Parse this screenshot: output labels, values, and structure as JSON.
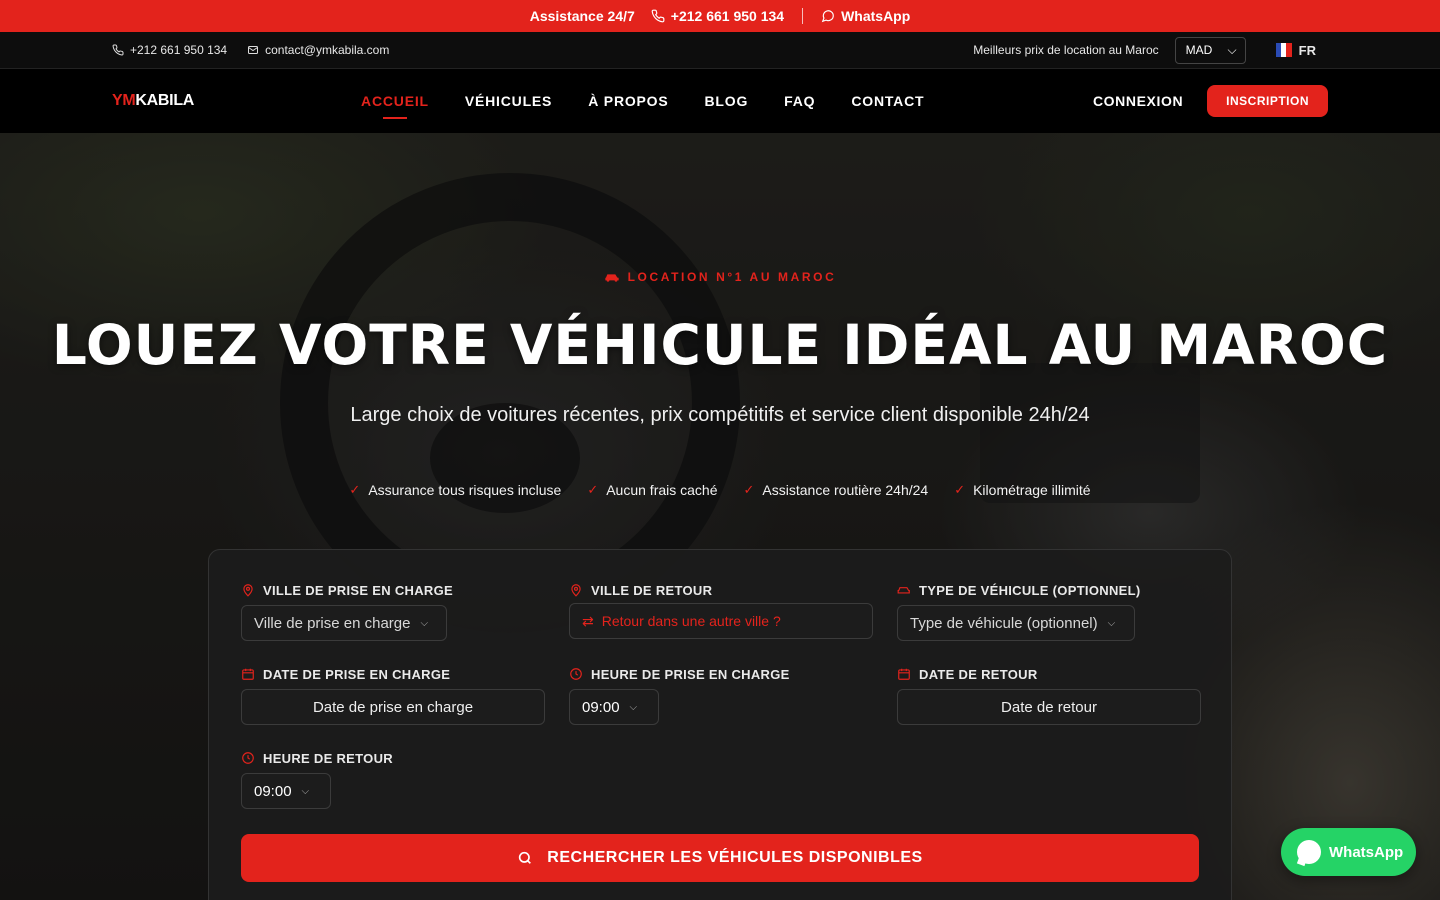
{
  "topbar": {
    "assistance": "Assistance 24/7",
    "phone": "+212 661 950 134",
    "whatsapp": "WhatsApp"
  },
  "contactbar": {
    "phone": "+212 661 950 134",
    "email": "contact@ymkabila.com",
    "tagline": "Meilleurs prix de location au Maroc",
    "currency": "MAD",
    "language": "FR"
  },
  "nav": {
    "logo_prefix": "YM",
    "logo_suffix": "KABILA",
    "items": [
      {
        "label": "ACCUEIL"
      },
      {
        "label": "VÉHICULES"
      },
      {
        "label": "À PROPOS"
      },
      {
        "label": "BLOG"
      },
      {
        "label": "FAQ"
      },
      {
        "label": "CONTACT"
      }
    ],
    "active_index": 0,
    "login": "CONNEXION",
    "register": "INSCRIPTION"
  },
  "hero": {
    "kicker": "LOCATION N°1 AU MAROC",
    "title": "LOUEZ VOTRE VÉHICULE IDÉAL AU MAROC",
    "subtitle": "Large choix de voitures récentes, prix compétitifs et service client disponible 24h/24",
    "features": [
      "Assurance tous risques incluse",
      "Aucun frais caché",
      "Assistance routière 24h/24",
      "Kilométrage illimité"
    ]
  },
  "search": {
    "pickup_city": {
      "label": "VILLE DE PRISE EN CHARGE",
      "placeholder": "Ville de prise en charge"
    },
    "return_city": {
      "label": "VILLE DE RETOUR",
      "value": "Retour dans une autre ville ?"
    },
    "vehicle_type": {
      "label": "TYPE DE VÉHICULE (OPTIONNEL)",
      "placeholder": "Type de véhicule (optionnel)"
    },
    "pickup_date": {
      "label": "DATE DE PRISE EN CHARGE",
      "placeholder": "Date de prise en charge"
    },
    "pickup_time": {
      "label": "HEURE DE PRISE EN CHARGE",
      "value": "09:00"
    },
    "return_date": {
      "label": "DATE DE RETOUR",
      "placeholder": "Date de retour"
    },
    "return_time": {
      "label": "HEURE DE RETOUR",
      "value": "09:00"
    },
    "submit": "RECHERCHER LES VÉHICULES DISPONIBLES"
  },
  "whatsapp_float": "WhatsApp",
  "colors": {
    "accent": "#e3231c",
    "whatsapp": "#25d366",
    "background": "#000000"
  }
}
